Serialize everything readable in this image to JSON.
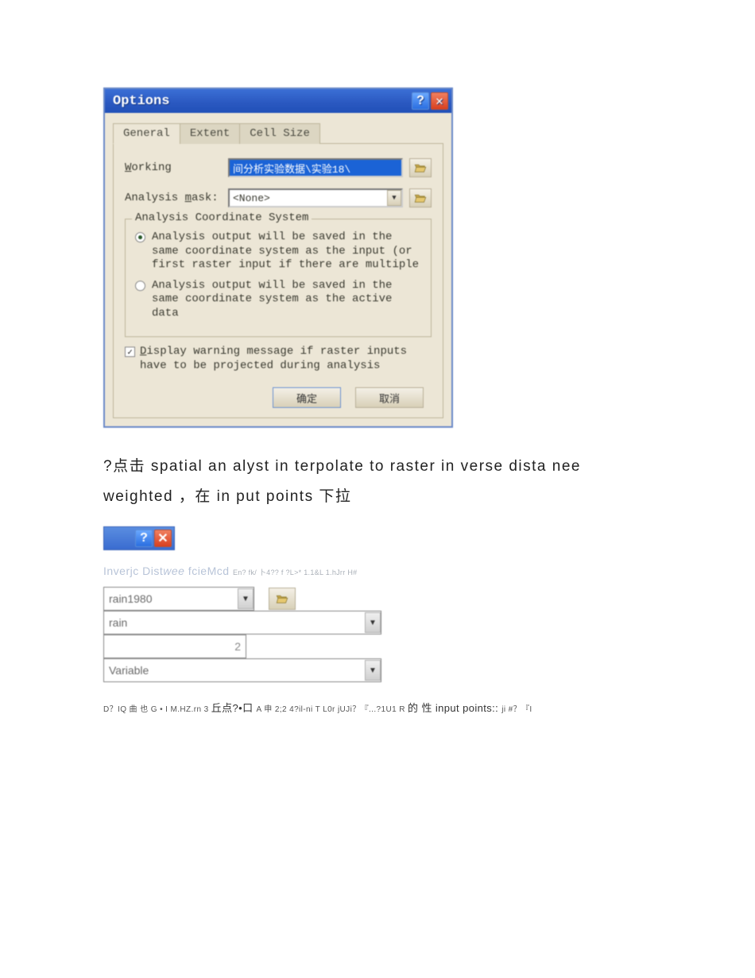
{
  "dialog": {
    "title": "Options",
    "tabs": [
      "General",
      "Extent",
      "Cell Size"
    ],
    "activeTab": 0,
    "working": {
      "label_pre": "W",
      "label_post": "orking",
      "value": "间分析实验数据\\实验18\\"
    },
    "mask": {
      "label_pre": "Analysis ",
      "label_mid": "m",
      "label_post": "ask:",
      "value": "<None>"
    },
    "coord": {
      "group_label": "Analysis Coordinate System",
      "option1": "Analysis output will be saved in the same coordinate system as the input (or first raster input if there are multiple",
      "option2": "Analysis output will be saved in the same coordinate system as the active data"
    },
    "warning": {
      "label_pre": "D",
      "label_rest": "isplay warning message if raster inputs have to be projected during analysis"
    },
    "ok": "确定",
    "cancel": "取消"
  },
  "body_text": "?点击 spatial an alyst in terpolate to raster in verse dista nee weighted ，在 in put points 下拉",
  "subheading": {
    "main_a": "Inverjc Dist",
    "main_b": "wee",
    "main_c": " fcieMcd ",
    "tail": "En? fk/ 卜4?? f ?L>* 1.1&L 1.hJrr H#"
  },
  "form2": {
    "row1": "rain1980",
    "row2": "rain",
    "row3": "2",
    "row4": "Variable"
  },
  "footnote": {
    "a": "D？IQ 曲 也 ",
    "b": "G • ",
    "c": "I M.HZ.rn 3 ",
    "d": "丘点?•口 ",
    "e": "A ",
    "f": "申 2;2 4?il-ni ",
    "g": "T ",
    "h": "L0r jUJi？『...?1U1 ",
    "i": "R ",
    "j": "的 性 ",
    "k": "input points:: ",
    "l": "ji #？『I"
  }
}
